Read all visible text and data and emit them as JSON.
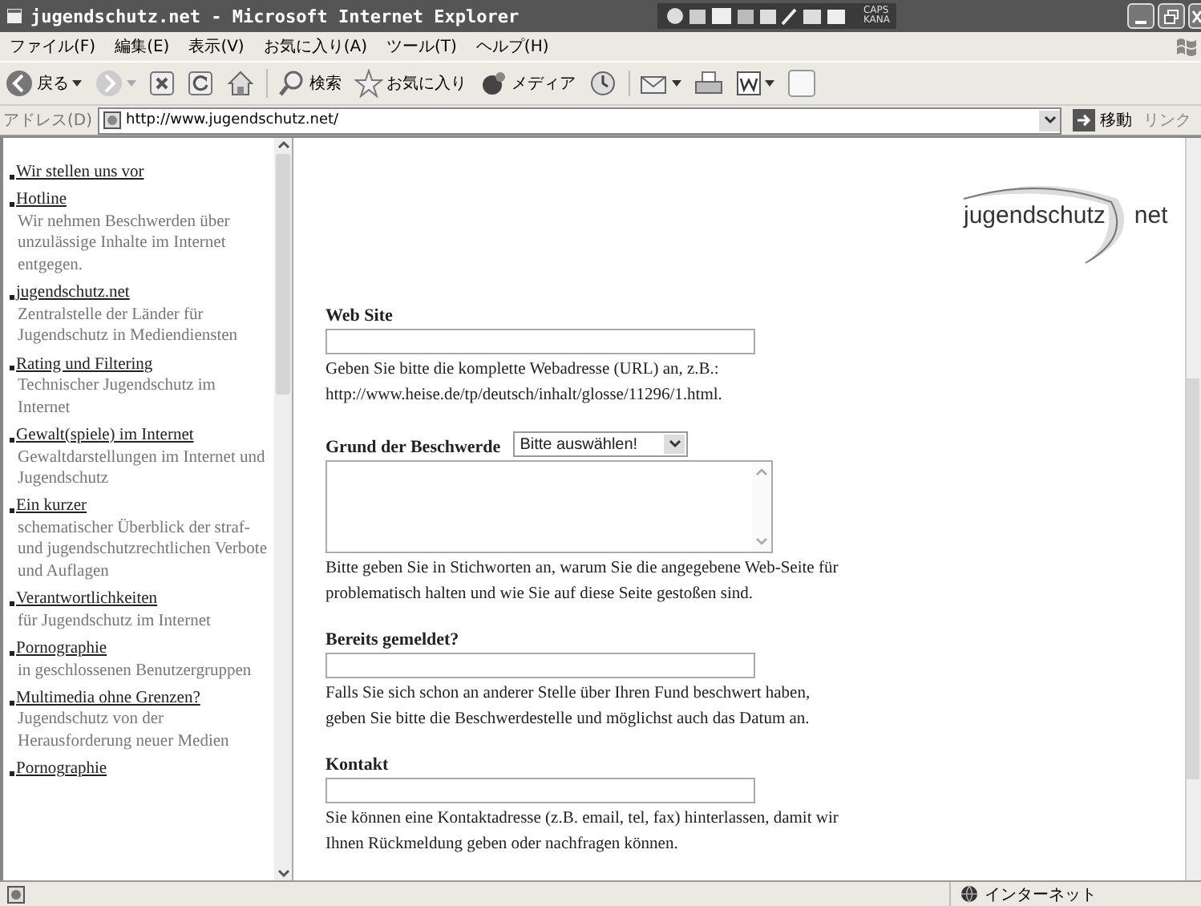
{
  "window": {
    "title": "jugendschutz.net - Microsoft Internet Explorer",
    "ime_indicators": [
      "CAPS",
      "KANA"
    ]
  },
  "menu": [
    "ファイル(F)",
    "編集(E)",
    "表示(V)",
    "お気に入り(A)",
    "ツール(T)",
    "ヘルプ(H)"
  ],
  "toolbar": [
    {
      "kind": "back",
      "label": "戻る"
    },
    {
      "kind": "forward"
    },
    {
      "kind": "stop"
    },
    {
      "kind": "refresh"
    },
    {
      "kind": "home"
    },
    {
      "kind": "search",
      "label": "検索"
    },
    {
      "kind": "favorites",
      "label": "お気に入り"
    },
    {
      "kind": "media",
      "label": "メディア"
    },
    {
      "kind": "history"
    },
    {
      "kind": "mail"
    },
    {
      "kind": "print"
    },
    {
      "kind": "word"
    },
    {
      "kind": "note"
    }
  ],
  "address": {
    "label": "アドレス(D)",
    "value": "http://www.jugendschutz.net/",
    "go": "移動",
    "links": "リンク"
  },
  "sidebar": {
    "items": [
      {
        "title": "Wir stellen uns vor"
      },
      {
        "title": "Hotline",
        "description": "Wir nehmen Beschwerden über unzulässige Inhalte im Internet entgegen."
      },
      {
        "title": "jugendschutz.net",
        "description": "Zentralstelle der Länder für Jugendschutz in Mediendiensten"
      },
      {
        "title": "Rating und Filtering",
        "description": "Technischer Jugendschutz im Internet"
      },
      {
        "title": "Gewalt(spiele) im Internet",
        "description": "Gewaltdarstellungen im Internet und Jugendschutz"
      },
      {
        "title": "Ein kurzer",
        "description": "schematischer Überblick der straf- und jugendschutzrechtlichen Verbote und Auflagen"
      },
      {
        "title": "Verantwortlichkeiten",
        "description": "für Jugendschutz im Internet"
      },
      {
        "title": "Pornographie",
        "description": "in geschlossenen Benutzergruppen"
      },
      {
        "title": "Multimedia ohne Grenzen?",
        "description": "Jugendschutz von der Herausforderung neuer Medien"
      },
      {
        "title": "Pornographie"
      }
    ]
  },
  "logo": {
    "name": "jugendschutz",
    "suffix": "net"
  },
  "form": [
    {
      "kind": "input",
      "label": "Web Site",
      "help": "Geben Sie bitte die komplette Webadresse (URL) an, z.B.: http://www.heise.de/tp/deutsch/inhalt/glosse/11296/1.html."
    },
    {
      "kind": "textarea",
      "label": "Grund der Beschwerde",
      "select": "Bitte auswählen!",
      "help": "Bitte geben Sie in Stichworten an, warum Sie die angegebene Web-Seite für problematisch halten und wie Sie auf diese Seite gestoßen sind."
    },
    {
      "kind": "input",
      "label": "Bereits gemeldet?",
      "help": "Falls Sie sich schon an anderer Stelle über Ihren Fund beschwert haben, geben Sie bitte die Beschwerdestelle und möglichst auch das Datum an."
    },
    {
      "kind": "input",
      "label": "Kontakt",
      "help": "Sie können eine Kontaktadresse (z.B. email, tel, fax) hinterlassen, damit wir Ihnen Rückmeldung geben oder nachfragen können."
    }
  ],
  "status_bar": {
    "zone": "インターネット"
  }
}
